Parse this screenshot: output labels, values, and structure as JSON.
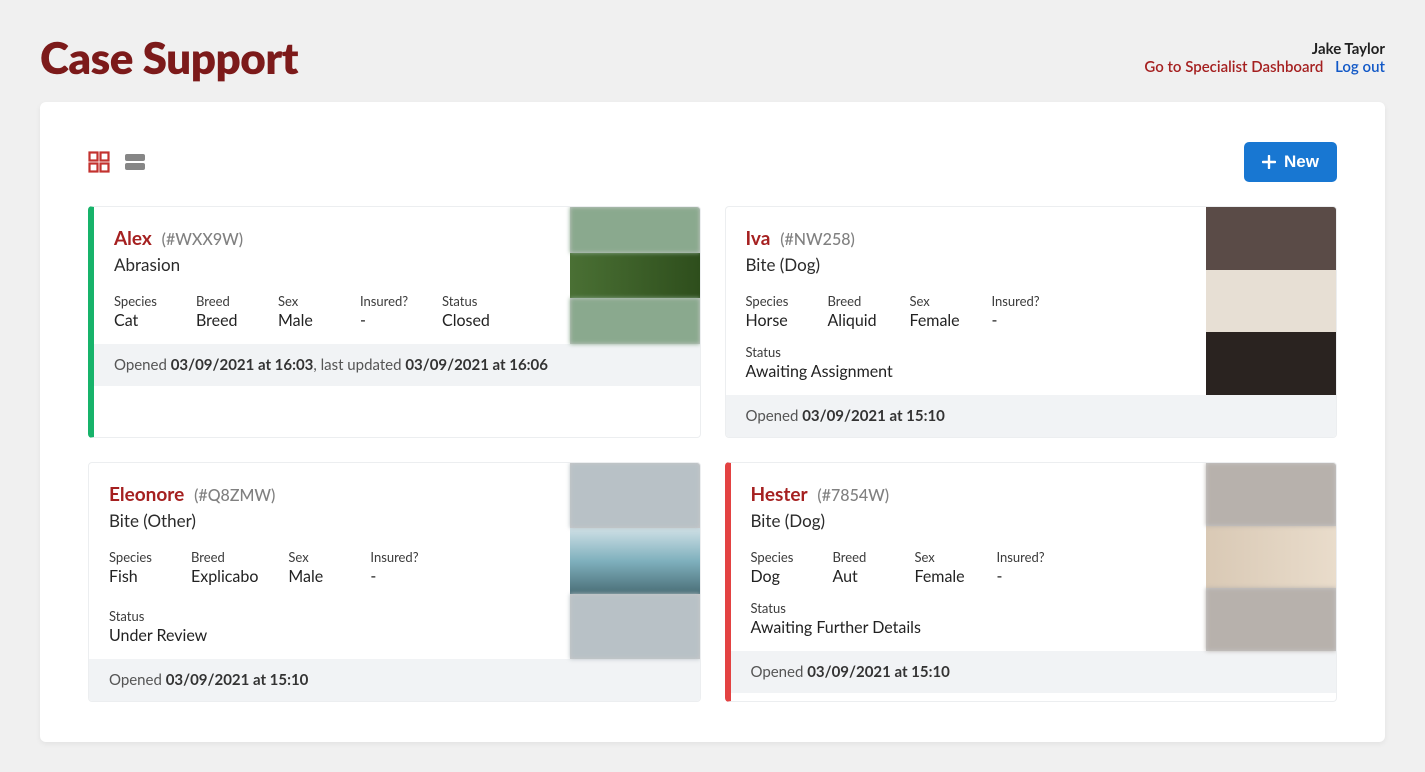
{
  "header": {
    "title": "Case Support",
    "user_name": "Jake Taylor",
    "specialist_link": "Go to Specialist Dashboard",
    "logout": "Log out"
  },
  "toolbar": {
    "new_label": "New"
  },
  "field_labels": {
    "species": "Species",
    "breed": "Breed",
    "sex": "Sex",
    "insured": "Insured?",
    "status": "Status"
  },
  "cases": {
    "0": {
      "name": "Alex",
      "id": "(#WXX9W)",
      "condition": "Abrasion",
      "species": "Cat",
      "breed": "Breed",
      "sex": "Male",
      "insured": "-",
      "status": "Closed",
      "footer_html_parts": {
        "opened_prefix": "Opened ",
        "opened_ts": "03/09/2021 at 16:03",
        "updated_prefix": ", last updated ",
        "updated_ts": "03/09/2021 at 16:06"
      }
    },
    "1": {
      "name": "Iva",
      "id": "(#NW258)",
      "condition": "Bite (Dog)",
      "species": "Horse",
      "breed": "Aliquid",
      "sex": "Female",
      "insured": "-",
      "status": "Awaiting Assignment",
      "footer_html_parts": {
        "opened_prefix": "Opened ",
        "opened_ts": "03/09/2021 at 15:10"
      }
    },
    "2": {
      "name": "Eleonore",
      "id": "(#Q8ZMW)",
      "condition": "Bite (Other)",
      "species": "Fish",
      "breed": "Explicabo",
      "sex": "Male",
      "insured": "-",
      "status": "Under Review",
      "footer_html_parts": {
        "opened_prefix": "Opened ",
        "opened_ts": "03/09/2021 at 15:10"
      }
    },
    "3": {
      "name": "Hester",
      "id": "(#7854W)",
      "condition": "Bite (Dog)",
      "species": "Dog",
      "breed": "Aut",
      "sex": "Female",
      "insured": "-",
      "status": "Awaiting Further Details",
      "footer_html_parts": {
        "opened_prefix": "Opened ",
        "opened_ts": "03/09/2021 at 15:10"
      }
    }
  }
}
